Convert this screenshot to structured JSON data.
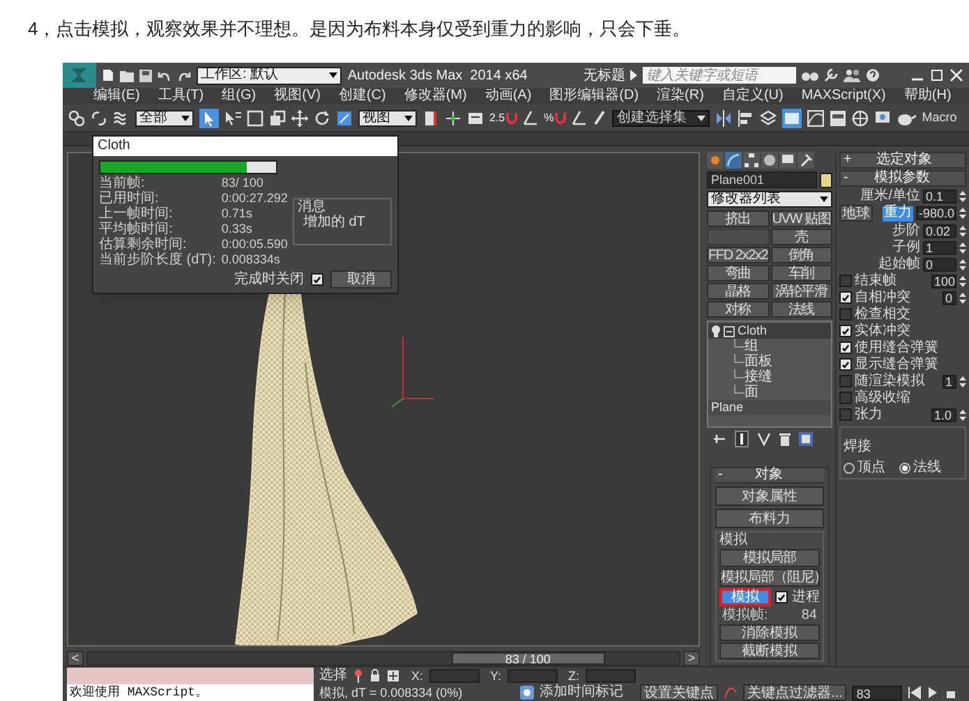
{
  "caption": "4，点击模拟，观察效果并不理想。是因为布料本身仅受到重力的影响，只会下垂。",
  "title_bar": {
    "workspace": "工作区: 默认",
    "title": "Autodesk 3ds Max  2014 x64",
    "document": "无标题",
    "search": {
      "placeholder": "键入关键字或短语"
    }
  },
  "menu": [
    "编辑(E)",
    "工具(T)",
    "组(G)",
    "视图(V)",
    "创建(C)",
    "修改器(M)",
    "动画(A)",
    "图形编辑器(D)",
    "渲染(R)",
    "自定义(U)",
    "MAXScript(X)",
    "帮助(H)"
  ],
  "toolbar": {
    "selection_filter": "全部",
    "reference_coord": "视图",
    "snap_labels": [
      "2.5",
      "%"
    ],
    "named_selection": {
      "placeholder": "创建选择集"
    },
    "macro": "Macro"
  },
  "cloth_dialog": {
    "title": "Cloth",
    "progress": {
      "level": 0.83
    },
    "stats": [
      {
        "label": "当前帧:",
        "value": "83/ 100"
      },
      {
        "label": "已用时间:",
        "value": "0:00:27.292"
      },
      {
        "label": "上一帧时间:",
        "value": "0.71s"
      },
      {
        "label": "平均帧时间:",
        "value": "0.33s"
      },
      {
        "label": "估算剩余时间:",
        "value": "0:00:05.590"
      },
      {
        "label": "当前步阶长度 (dT):",
        "value": "0.008334s"
      }
    ],
    "message_group": "消息",
    "message": "增加的 dT",
    "close_on_finish": {
      "label": "完成时关闭",
      "checked": true
    },
    "cancel": "取消"
  },
  "timeline": {
    "prev": "<",
    "readout": "83 / 100",
    "next": ">",
    "level": 0.83
  },
  "command_panel": {
    "object_name": "Plane001",
    "modifier_list": "修改器列表",
    "modifier_buttons": [
      {
        "left": "挤出",
        "right": "UVW 贴图"
      },
      {
        "right": "壳"
      },
      {
        "left": "FFD 2x2x2",
        "right": "倒角"
      },
      {
        "left": "弯曲",
        "right": "车削"
      },
      {
        "left": "晶格",
        "right": "涡轮平滑"
      },
      {
        "left": "对称",
        "right": "法线"
      }
    ],
    "stack": [
      {
        "name": "Cloth",
        "selected": true,
        "expanded": true,
        "children": [
          {
            "name": "组"
          },
          {
            "name": "面板"
          },
          {
            "name": "接缝"
          },
          {
            "name": "面"
          }
        ]
      },
      {
        "name": "Plane",
        "selected": false
      }
    ],
    "object_rollout": {
      "sign": "-",
      "title": "对象",
      "buttons": [
        "对象属性",
        "布料力"
      ],
      "simulation_group": "模拟",
      "sim_buttons": [
        "模拟局部",
        "模拟局部（阻尼）"
      ],
      "simulate": {
        "label": "模拟",
        "selected": true
      },
      "progress_checkbox": {
        "label": "进程",
        "checked": true
      },
      "sim_frame": {
        "label": "模拟帧:",
        "value": "84"
      },
      "more_buttons": [
        "消除模拟",
        "截断模拟"
      ]
    },
    "rollouts": [
      {
        "sign": "+",
        "title": "选定对象"
      },
      {
        "sign": "-",
        "title": "模拟参数"
      }
    ],
    "sim_params": [
      {
        "kind": "field",
        "label": "厘米/单位",
        "value": "0.1"
      },
      {
        "kind": "gravity",
        "button": "地球",
        "label": "重力",
        "selected": true,
        "value": "-980.0"
      },
      {
        "kind": "field",
        "label": "步阶",
        "value": "0.02"
      },
      {
        "kind": "field",
        "label": "子例",
        "value": "1"
      },
      {
        "kind": "field",
        "label": "起始帧",
        "value": "0"
      },
      {
        "kind": "check",
        "label": "结束帧",
        "checked": false,
        "value": "100"
      },
      {
        "kind": "check",
        "label": "自相冲突",
        "checked": true,
        "value": "0"
      },
      {
        "kind": "check",
        "label": "检查相交",
        "checked": false
      },
      {
        "kind": "check",
        "label": "实体冲突",
        "checked": true
      },
      {
        "kind": "check",
        "label": "使用缝合弹簧",
        "checked": true
      },
      {
        "kind": "check",
        "label": "显示缝合弹簧",
        "checked": true
      },
      {
        "kind": "check",
        "label": "随渲染模拟",
        "checked": false,
        "value": "1"
      },
      {
        "kind": "check",
        "label": "高级收缩",
        "checked": false
      },
      {
        "kind": "check",
        "label": "张力",
        "checked": false,
        "value": "1.0"
      }
    ],
    "weld": {
      "title": "焊接",
      "options": [
        {
          "label": "顶点",
          "selected": false
        },
        {
          "label": "法线",
          "selected": true
        }
      ]
    }
  },
  "status_bar": {
    "maxscript_output": "欢迎使用 MAXScript。",
    "selection_label": "选择",
    "coords": [
      "X:",
      "Y:",
      "Z:"
    ],
    "prompt": "模拟, dT = 0.008334 (0%)",
    "add_time_tag": "添加时间标记",
    "set_key": "设置关键点",
    "key_filters": "关键点过滤器...",
    "frame": "83"
  }
}
